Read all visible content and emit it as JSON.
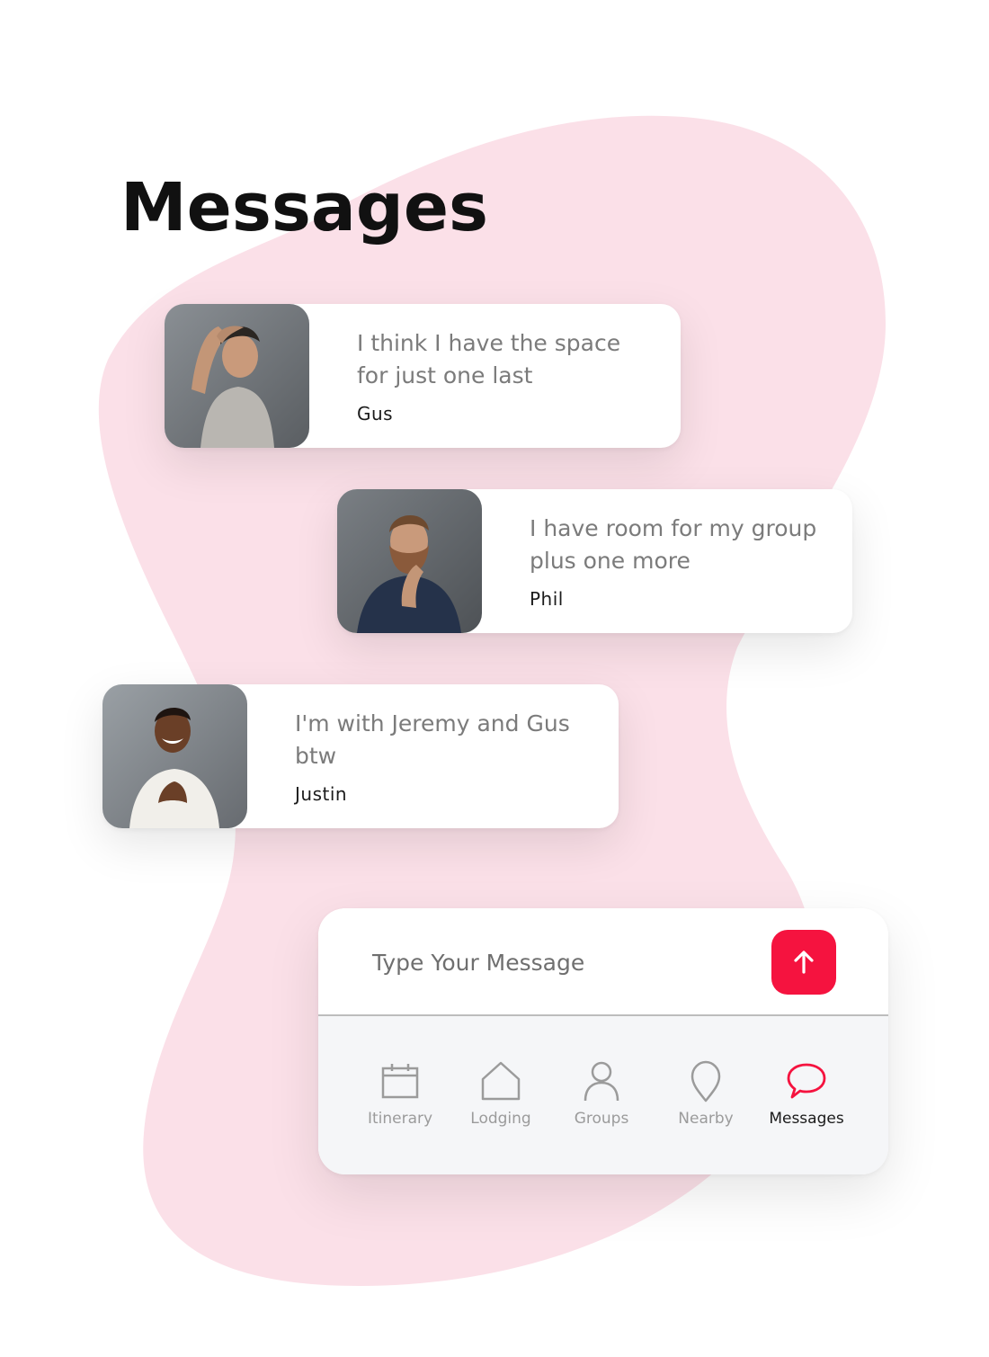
{
  "page": {
    "title": "Messages"
  },
  "colors": {
    "accent": "#f5133f",
    "blob": "#fbe0e8"
  },
  "messages": [
    {
      "text": "I think I have the space for just one last",
      "sender": "Gus",
      "avatar": "avatar-photo-gus"
    },
    {
      "text": "I have room for my group plus one more",
      "sender": "Phil",
      "avatar": "avatar-photo-phil"
    },
    {
      "text": "I'm with Jeremy and Gus btw",
      "sender": "Justin",
      "avatar": "avatar-photo-justin"
    }
  ],
  "composer": {
    "placeholder": "Type Your Message",
    "send_icon": "arrow-up-icon"
  },
  "tabs": [
    {
      "label": "Itinerary",
      "icon": "calendar-icon",
      "active": false
    },
    {
      "label": "Lodging",
      "icon": "home-icon",
      "active": false
    },
    {
      "label": "Groups",
      "icon": "person-icon",
      "active": false
    },
    {
      "label": "Nearby",
      "icon": "location-pin-icon",
      "active": false
    },
    {
      "label": "Messages",
      "icon": "chat-bubble-icon",
      "active": true
    }
  ]
}
